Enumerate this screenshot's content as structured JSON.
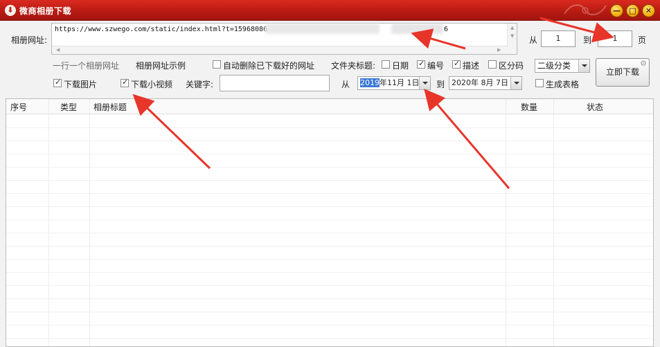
{
  "window": {
    "title": "微商相册下载",
    "min": "—",
    "max": "□",
    "close": "✕"
  },
  "url": {
    "label": "相册网址:",
    "value_head": "https://www.szwego.com/static/index.html?t=15968086",
    "value_tail": "6"
  },
  "page_range": {
    "from_label": "从",
    "from_value": "1",
    "to_label": "到",
    "to_value": "1",
    "unit_label": "页"
  },
  "row2": {
    "hint": "一行一个相册网址",
    "example_link": "相册网址示例",
    "auto_delete": {
      "label": "自动删除已下载好的网址",
      "checked": false
    },
    "folder_title_label": "文件夹标题:",
    "folder_options": [
      {
        "label": "日期",
        "checked": false
      },
      {
        "label": "编号",
        "checked": true
      },
      {
        "label": "描述",
        "checked": true
      },
      {
        "label": "区分码",
        "checked": false
      }
    ],
    "category_select": "二级分类"
  },
  "row3": {
    "download_images": {
      "label": "下载图片",
      "checked": true
    },
    "download_videos": {
      "label": "下载小视频",
      "checked": true
    },
    "keyword_label": "关键字:",
    "keyword_value": "",
    "date_from_label": "从",
    "date_from_year": "2019",
    "date_from_rest": "年11月 1日",
    "date_to_label": "到",
    "date_to": "2020年 8月 7日",
    "gen_table": {
      "label": "生成表格",
      "checked": false
    }
  },
  "download_button": "立即下载",
  "table": {
    "columns": [
      "序号",
      "类型",
      "相册标题",
      "数量",
      "状态"
    ],
    "rows": []
  },
  "colors": {
    "titlebar": "#c8231a",
    "annotation_arrow": "#e8352a",
    "selection": "#3a78d6"
  }
}
